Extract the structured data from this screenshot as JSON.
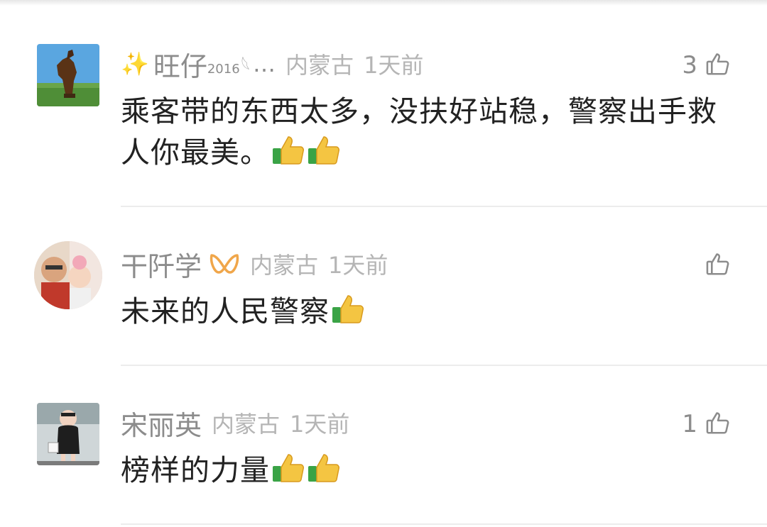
{
  "comments": [
    {
      "username": "旺仔",
      "username_suffix": "2016",
      "ellipsis": "…",
      "location": "内蒙古",
      "time": "1天前",
      "likes": "3",
      "text": "乘客带的东西太多，没扶好站稳，警察出手救人你最美。",
      "emoji_count": 2,
      "avatar": "horse-rider-statue"
    },
    {
      "username": "干阡学",
      "location": "内蒙古",
      "time": "1天前",
      "likes": "",
      "text": "未来的人民警察",
      "emoji_count": 1,
      "avatar": "man-with-baby-photo"
    },
    {
      "username": "宋丽英",
      "location": "内蒙古",
      "time": "1天前",
      "likes": "1",
      "text": "榜样的力量",
      "emoji_count": 2,
      "avatar": "cartoon-character-photo"
    }
  ],
  "icons": {
    "like": "thumbs-up-outline-icon",
    "emoji": "thumbs-up-emoji",
    "sparkle": "sparkle-icon",
    "vip": "vip-badge-icon"
  },
  "colors": {
    "username": "#8c8c8c",
    "meta": "#b5b5b5",
    "text": "#222222",
    "vip": "#f0a64a"
  }
}
